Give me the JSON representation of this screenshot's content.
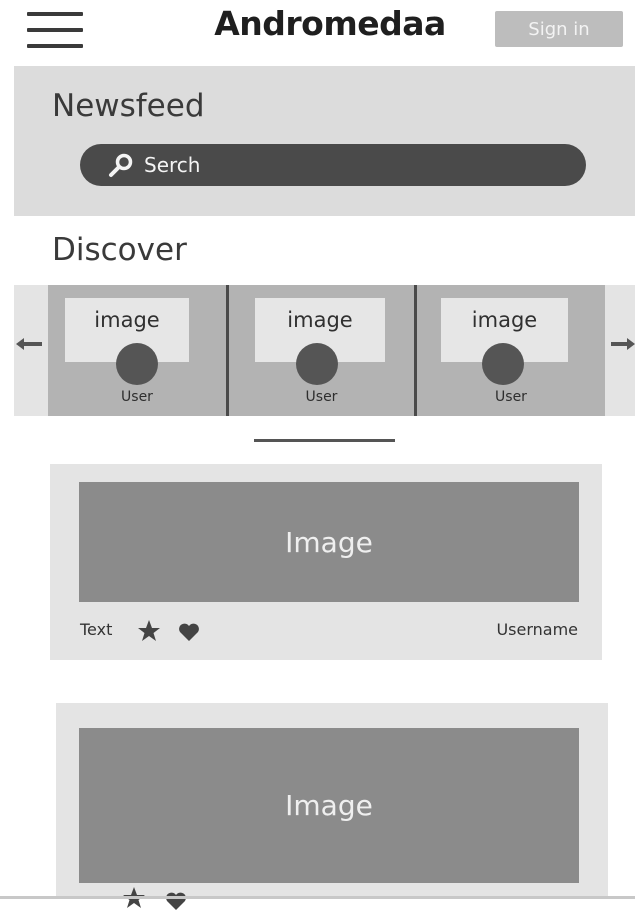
{
  "header": {
    "menu_icon": "hamburger-menu-icon",
    "app_title": "Andromedaa",
    "sign_in_label": "Sign in"
  },
  "newsfeed": {
    "title": "Newsfeed",
    "search": {
      "label": "Serch",
      "icon": "search-icon"
    }
  },
  "discover": {
    "title": "Discover",
    "left_arrow_icon": "arrow-left-icon",
    "right_arrow_icon": "arrow-right-icon",
    "cards": [
      {
        "image_label": "image",
        "user_label": "User"
      },
      {
        "image_label": "image",
        "user_label": "User"
      },
      {
        "image_label": "image",
        "user_label": "User"
      }
    ]
  },
  "posts": [
    {
      "image_label": "Image",
      "text": "Text",
      "username": "Username",
      "icons": [
        "star-icon",
        "heart-icon"
      ]
    },
    {
      "image_label": "Image",
      "icons": [
        "star-icon",
        "heart-icon"
      ]
    }
  ],
  "colors": {
    "band": "#dcdcdc",
    "search_bar": "#4a4a4a",
    "card": "#b3b3b3",
    "post_image": "#8b8b8b",
    "sign_in_button": "#bdbdbd"
  }
}
